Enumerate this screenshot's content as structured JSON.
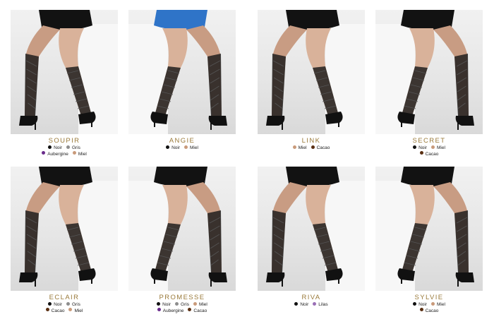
{
  "colors": {
    "Noir": "#111111",
    "Gris": "#8d8d8d",
    "Miel": "#c99a7a",
    "Aubergine": "#6a2c8c",
    "Cacao": "#5a2f12",
    "Lilas": "#9a6fb6"
  },
  "products": [
    {
      "name": "SOUPIR",
      "image": "legs-patterned-knee-socks-seated",
      "swatches": [
        [
          "Noir",
          "Gris"
        ],
        [
          "Aubergine",
          "Miel"
        ]
      ]
    },
    {
      "name": "ANGIE",
      "image": "legs-dot-knee-socks-blue-top",
      "swatches": [
        [
          "Noir",
          "Miel"
        ]
      ]
    },
    {
      "name": "LINK",
      "image": "legs-diamond-knee-socks-on-stool",
      "swatches": [
        [
          "Miel",
          "Cacao"
        ]
      ]
    },
    {
      "name": "SECRET",
      "image": "legs-geometric-knee-socks-black-dress",
      "swatches": [
        [
          "Noir",
          "Miel"
        ],
        [
          "Cacao"
        ]
      ]
    },
    {
      "name": "ECLAIR",
      "image": "legs-floral-knee-socks-black-skirt",
      "swatches": [
        [
          "Noir",
          "Gris"
        ],
        [
          "Cacao",
          "Miel"
        ]
      ]
    },
    {
      "name": "PROMESSE",
      "image": "legs-argyle-knee-socks-black-skirt",
      "swatches": [
        [
          "Noir",
          "Gris",
          "Miel"
        ],
        [
          "Aubergine",
          "Cacao"
        ]
      ]
    },
    {
      "name": "RIVA",
      "image": "legs-chevron-knee-socks",
      "swatches": [
        [
          "Noir",
          "Lilas"
        ]
      ]
    },
    {
      "name": "SYLVIE",
      "image": "legs-lace-knee-socks-black-dress",
      "swatches": [
        [
          "Noir",
          "Miel"
        ],
        [
          "Cacao"
        ]
      ]
    }
  ]
}
